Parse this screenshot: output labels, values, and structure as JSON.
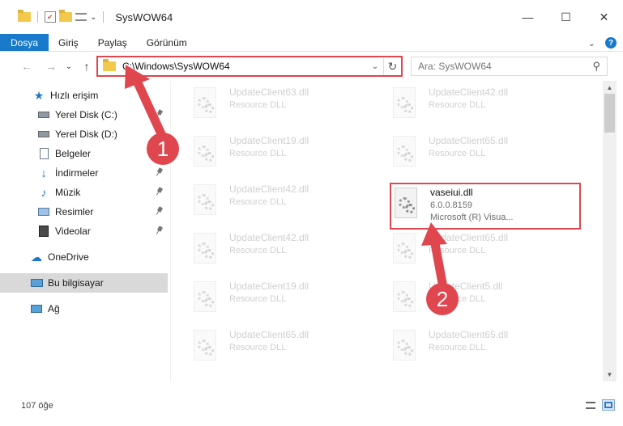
{
  "window": {
    "title": "SysWOW64",
    "minimize": "—",
    "maximize": "☐",
    "close": "✕"
  },
  "ribbon": {
    "tabs": [
      {
        "label": "Dosya",
        "active": true
      },
      {
        "label": "Giriş"
      },
      {
        "label": "Paylaş"
      },
      {
        "label": "Görünüm"
      }
    ],
    "collapse": "⌄",
    "help": "?"
  },
  "nav": {
    "back": "←",
    "forward": "→",
    "recent": "⌄",
    "up": "↑",
    "address": "C:\\Windows\\SysWOW64",
    "address_drop": "⌄",
    "refresh": "↻",
    "search_placeholder": "Ara: SysWOW64",
    "search_icon": "magnifier-icon"
  },
  "sidebar": {
    "items": [
      {
        "label": "Hızlı erişim",
        "icon": "star-icon",
        "pinned": false,
        "selected": false
      },
      {
        "label": "Yerel Disk (C:)",
        "icon": "drive-icon",
        "pinned": true,
        "selected": false
      },
      {
        "label": "Yerel Disk (D:)",
        "icon": "drive-icon",
        "pinned": true,
        "selected": false
      },
      {
        "label": "Belgeler",
        "icon": "documents-icon",
        "pinned": true,
        "selected": false
      },
      {
        "label": "İndirmeler",
        "icon": "download-icon",
        "pinned": true,
        "selected": false
      },
      {
        "label": "Müzik",
        "icon": "music-icon",
        "pinned": true,
        "selected": false
      },
      {
        "label": "Resimler",
        "icon": "pictures-icon",
        "pinned": true,
        "selected": false
      },
      {
        "label": "Videolar",
        "icon": "videos-icon",
        "pinned": true,
        "selected": false
      },
      {
        "label": "OneDrive",
        "icon": "onedrive-icon",
        "pinned": false,
        "selected": false
      },
      {
        "label": "Bu bilgisayar",
        "icon": "computer-icon",
        "pinned": false,
        "selected": true
      },
      {
        "label": "Ağ",
        "icon": "network-icon",
        "pinned": false,
        "selected": false
      }
    ]
  },
  "files": [
    {
      "name": "UpdateClient63.dll",
      "sub": "Resource DLL",
      "faded": true
    },
    {
      "name": "UpdateClient42.dll",
      "sub": "Resource DLL",
      "faded": true
    },
    {
      "name": "UpdateClient19.dll",
      "sub": "Resource DLL",
      "faded": true
    },
    {
      "name": "UpdateClient65.dll",
      "sub": "Resource DLL",
      "faded": true
    },
    {
      "name": "UpdateClient42.dll",
      "sub": "Resource DLL",
      "faded": true
    },
    {
      "name": "vaseiui.dll",
      "sub": "6.0.0.8159",
      "sub2": "Microsoft (R) Visua...",
      "faded": false
    },
    {
      "name": "UpdateClient42.dll",
      "sub": "Resource DLL",
      "faded": true
    },
    {
      "name": "UpdateClient65.dll",
      "sub": "Resource DLL",
      "faded": true
    },
    {
      "name": "UpdateClient19.dll",
      "sub": "Resource DLL",
      "faded": true
    },
    {
      "name": "UpdateClient5.dll",
      "sub": "Resource DLL",
      "faded": true
    },
    {
      "name": "UpdateClient65.dll",
      "sub": "Resource DLL",
      "faded": true
    },
    {
      "name": "UpdateClient65.dll",
      "sub": "Resource DLL",
      "faded": true
    }
  ],
  "status": {
    "count": "107 öğe"
  },
  "annotations": {
    "step1": "1",
    "step2": "2",
    "color": "#e0464e"
  }
}
